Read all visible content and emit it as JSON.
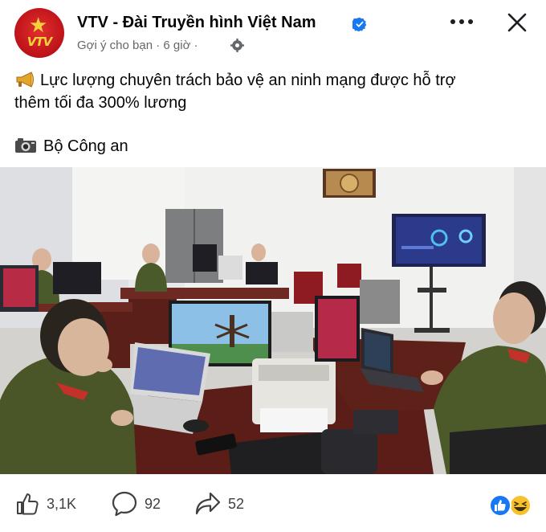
{
  "post": {
    "page_name": "VTV - Đài Truyền hình Việt Nam",
    "avatar_text": "VTV",
    "meta": "Gợi ý cho bạn · 6 giờ ·",
    "text_lines": [
      "Lực lượng chuyên trách bảo vệ an ninh mạng được hỗ trợ",
      "thêm tối đa 300% lương"
    ],
    "photo_credit": "Bộ Công an"
  },
  "engagement": {
    "likes": "3,1K",
    "comments": "92",
    "shares": "52"
  },
  "icons": {
    "verified": "verified-badge-icon",
    "privacy": "globe-icon",
    "more": "more-options-icon",
    "close": "close-icon",
    "like": "thumbs-up-icon",
    "comment": "comment-bubble-icon",
    "share": "share-arrow-icon",
    "reaction_like": "like-reaction-icon",
    "reaction_haha": "haha-reaction-icon"
  },
  "colors": {
    "verified_blue": "#1877f2",
    "brand_red": "#c3161c",
    "muted_text": "#65676b"
  }
}
